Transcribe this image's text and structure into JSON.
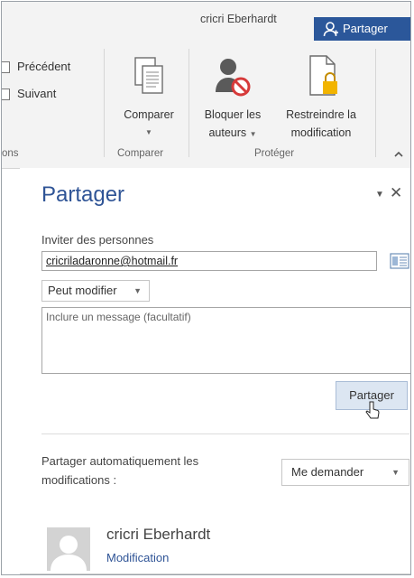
{
  "titlebar": {
    "user_name": "cricri Eberhardt",
    "share_label": "Partager"
  },
  "ribbon": {
    "nav": {
      "previous_label": "Précédent",
      "next_label": "Suivant",
      "group_label_partial": "ons"
    },
    "compare": {
      "button_label": "Comparer",
      "group_label": "Comparer"
    },
    "protect": {
      "block_authors_line1": "Bloquer les",
      "block_authors_line2": "auteurs",
      "restrict_line1": "Restreindre la",
      "restrict_line2": "modification",
      "group_label": "Protéger"
    },
    "collapse_icon": "chevron-up-icon"
  },
  "share_pane": {
    "title": "Partager",
    "invite_label": "Inviter des personnes",
    "email_value": "cricriladaronne@hotmail.fr",
    "permission_selected": "Peut modifier",
    "message_placeholder": "Inclure un message (facultatif)",
    "share_button_label": "Partager",
    "auto_share_label": "Partager automatiquement les modifications :",
    "auto_share_selected": "Me demander",
    "person": {
      "name": "cricri Eberhardt",
      "role": "Modification"
    }
  },
  "colors": {
    "accent": "#2b579a",
    "title_blue": "#2f5496",
    "ribbon_bg": "#f3f3f3",
    "button_bg": "#dce6f2"
  }
}
